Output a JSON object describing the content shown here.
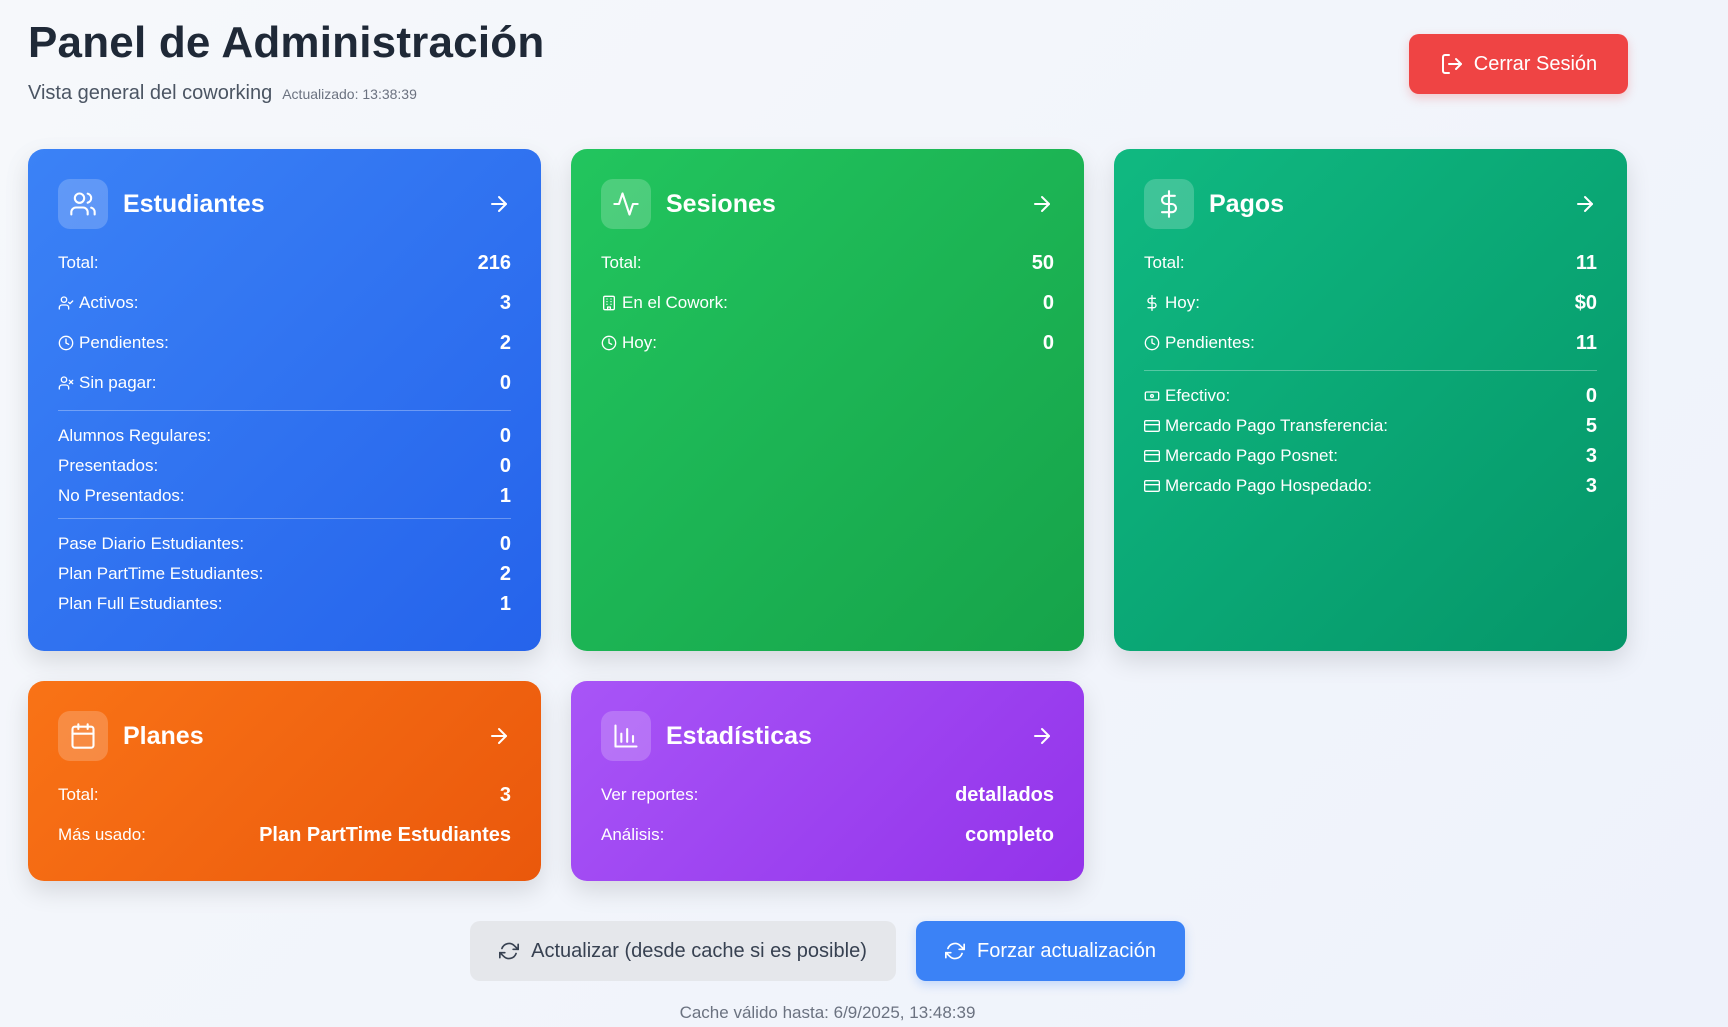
{
  "header": {
    "title": "Panel de Administración",
    "subtitle": "Vista general del coworking",
    "updated": "Actualizado: 13:38:39",
    "logout_label": "Cerrar Sesión"
  },
  "colors": {
    "estudiantes": "#3b82f6",
    "sesiones": "#22c55e",
    "pagos": "#10b981",
    "planes": "#f97316",
    "estadisticas": "#a855f7",
    "logout": "#ef4444"
  },
  "cards": {
    "estudiantes": {
      "title": "Estudiantes",
      "icon": "users-icon",
      "total_label": "Total:",
      "total_value": "216",
      "activos_label": "Activos:",
      "activos_value": "3",
      "pendientes_label": "Pendientes:",
      "pendientes_value": "2",
      "sin_pagar_label": "Sin pagar:",
      "sin_pagar_value": "0",
      "regulares_label": "Alumnos Regulares:",
      "regulares_value": "0",
      "presentados_label": "Presentados:",
      "presentados_value": "0",
      "no_presentados_label": "No Presentados:",
      "no_presentados_value": "1",
      "pase_diario_label": "Pase Diario Estudiantes:",
      "pase_diario_value": "0",
      "plan_parttime_label": "Plan PartTime Estudiantes:",
      "plan_parttime_value": "2",
      "plan_full_label": "Plan Full Estudiantes:",
      "plan_full_value": "1"
    },
    "sesiones": {
      "title": "Sesiones",
      "icon": "activity-icon",
      "total_label": "Total:",
      "total_value": "50",
      "cowork_label": "En el Cowork:",
      "cowork_value": "0",
      "hoy_label": "Hoy:",
      "hoy_value": "0"
    },
    "pagos": {
      "title": "Pagos",
      "icon": "dollar-icon",
      "total_label": "Total:",
      "total_value": "11",
      "hoy_label": "Hoy:",
      "hoy_value": "$0",
      "pendientes_label": "Pendientes:",
      "pendientes_value": "11",
      "efectivo_label": "Efectivo:",
      "efectivo_value": "0",
      "mp_transferencia_label": "Mercado Pago Transferencia:",
      "mp_transferencia_value": "5",
      "mp_posnet_label": "Mercado Pago Posnet:",
      "mp_posnet_value": "3",
      "mp_hospedado_label": "Mercado Pago Hospedado:",
      "mp_hospedado_value": "3"
    },
    "planes": {
      "title": "Planes",
      "icon": "calendar-icon",
      "total_label": "Total:",
      "total_value": "3",
      "mas_usado_label": "Más usado:",
      "mas_usado_value": "Plan PartTime Estudiantes"
    },
    "estadisticas": {
      "title": "Estadísticas",
      "icon": "bar-chart-icon",
      "reportes_label": "Ver reportes:",
      "reportes_value": "detallados",
      "analisis_label": "Análisis:",
      "analisis_value": "completo"
    }
  },
  "actions": {
    "refresh_cache_label": "Actualizar (desde cache si es posible)",
    "force_refresh_label": "Forzar actualización",
    "cache_note": "Cache válido hasta: 6/9/2025, 13:48:39"
  }
}
